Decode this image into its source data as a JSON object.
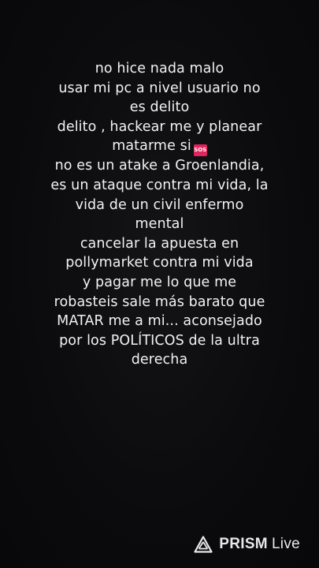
{
  "message": {
    "lines": [
      "no hice nada malo",
      "usar mi pc a nivel usuario no",
      "es delito",
      "delito , hackear me y planear",
      "matarme si",
      "no es un atake a Groenlandia,",
      "es un ataque contra mi vida, la",
      "vida de un civil enfermo",
      "mental",
      "cancelar la apuesta en",
      "pollymarket contra mi vida",
      "y pagar me lo que me",
      "robasteis sale más barato que",
      "MATAR me a mi... aconsejado",
      "por los POLÍTICOS de la ultra",
      "derecha"
    ],
    "emoji": {
      "name": "sos-emoji-icon",
      "label": "SOS",
      "color": "#e0245e"
    }
  },
  "watermark": {
    "brand": "PRISM",
    "suffix": "Live",
    "icon": "prism-logo-icon"
  }
}
